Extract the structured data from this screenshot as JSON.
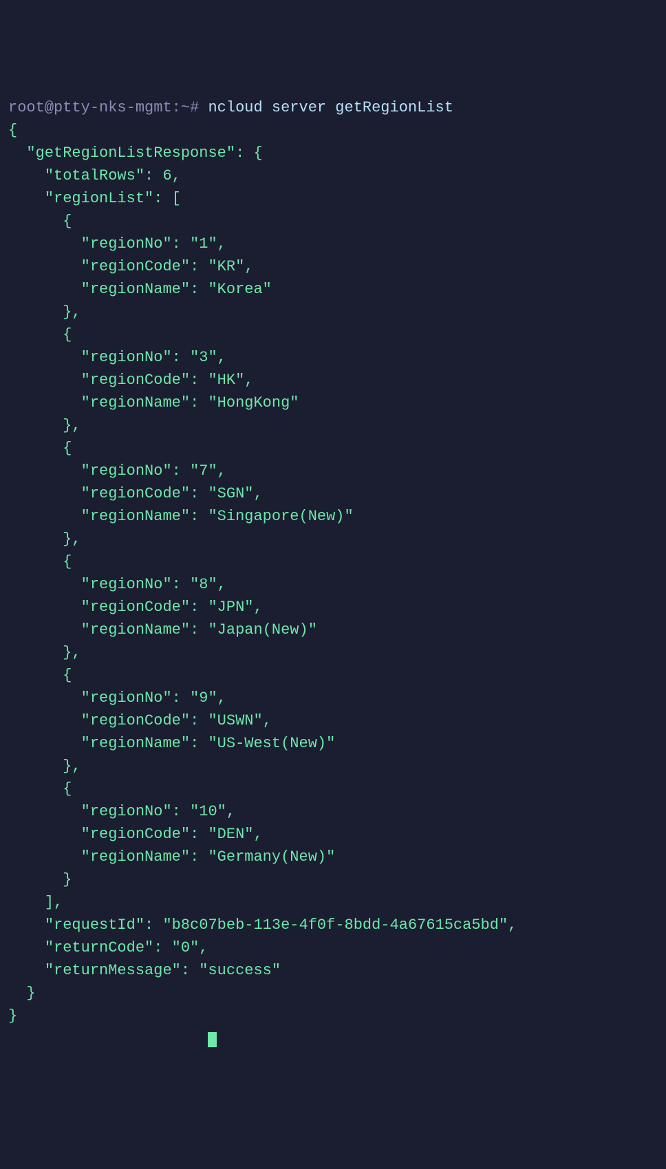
{
  "prompt": {
    "user": "root",
    "at": "@",
    "host": "ptty-nks-mgmt",
    "colon": ":",
    "path": "~",
    "hash": "#",
    "command": "ncloud server getRegionList"
  },
  "responseKey": "getRegionListResponse",
  "totalRowsKey": "totalRows",
  "totalRowsValue": "6",
  "regionListKey": "regionList",
  "regions": [
    {
      "regionNo": "1",
      "regionCode": "KR",
      "regionName": "Korea"
    },
    {
      "regionNo": "3",
      "regionCode": "HK",
      "regionName": "HongKong"
    },
    {
      "regionNo": "7",
      "regionCode": "SGN",
      "regionName": "Singapore(New)"
    },
    {
      "regionNo": "8",
      "regionCode": "JPN",
      "regionName": "Japan(New)"
    },
    {
      "regionNo": "9",
      "regionCode": "USWN",
      "regionName": "US-West(New)"
    },
    {
      "regionNo": "10",
      "regionCode": "DEN",
      "regionName": "Germany(New)"
    }
  ],
  "requestIdKey": "requestId",
  "requestIdValue": "b8c07beb-113e-4f0f-8bdd-4a67615ca5bd",
  "returnCodeKey": "returnCode",
  "returnCodeValue": "0",
  "returnMessageKey": "returnMessage",
  "returnMessageValue": "success",
  "labels": {
    "regionNo": "regionNo",
    "regionCode": "regionCode",
    "regionName": "regionName"
  }
}
